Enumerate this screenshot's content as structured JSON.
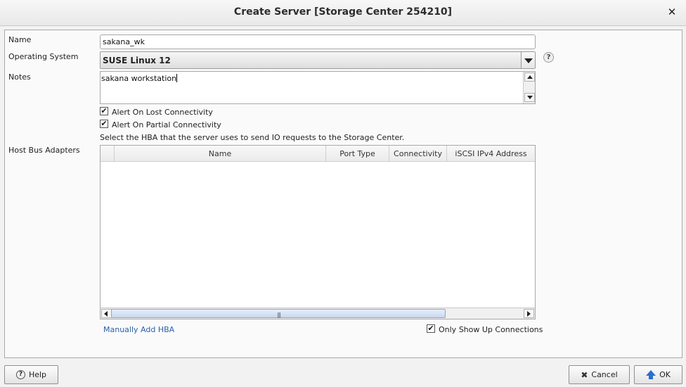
{
  "dialog": {
    "title": "Create Server [Storage Center 254210]",
    "close_glyph": "✕"
  },
  "form": {
    "name_label": "Name",
    "name_value": "sakana_wk",
    "os_label": "Operating System",
    "os_value": "SUSE Linux 12",
    "os_help_glyph": "?",
    "notes_label": "Notes",
    "notes_value": "sakana workstation",
    "alert_lost": {
      "label": "Alert On Lost Connectivity",
      "checked": true
    },
    "alert_partial": {
      "label": "Alert On Partial Connectivity",
      "checked": true
    },
    "hba_hint": "Select the HBA that the server uses to send IO requests to the Storage Center.",
    "hba_label": "Host Bus Adapters"
  },
  "hba_table": {
    "columns": [
      "Name",
      "Port Type",
      "Connectivity",
      "iSCSI IPv4 Address"
    ],
    "rows": [],
    "grip_glyph": "|||"
  },
  "links": {
    "manually_add": "Manually Add HBA"
  },
  "filters": {
    "only_up": {
      "label": "Only Show Up Connections",
      "checked": true
    }
  },
  "footer": {
    "help_label": "Help",
    "cancel_label": "Cancel",
    "ok_label": "OK"
  },
  "colors": {
    "accent": "#2a6fd0",
    "link": "#2a62a8"
  }
}
